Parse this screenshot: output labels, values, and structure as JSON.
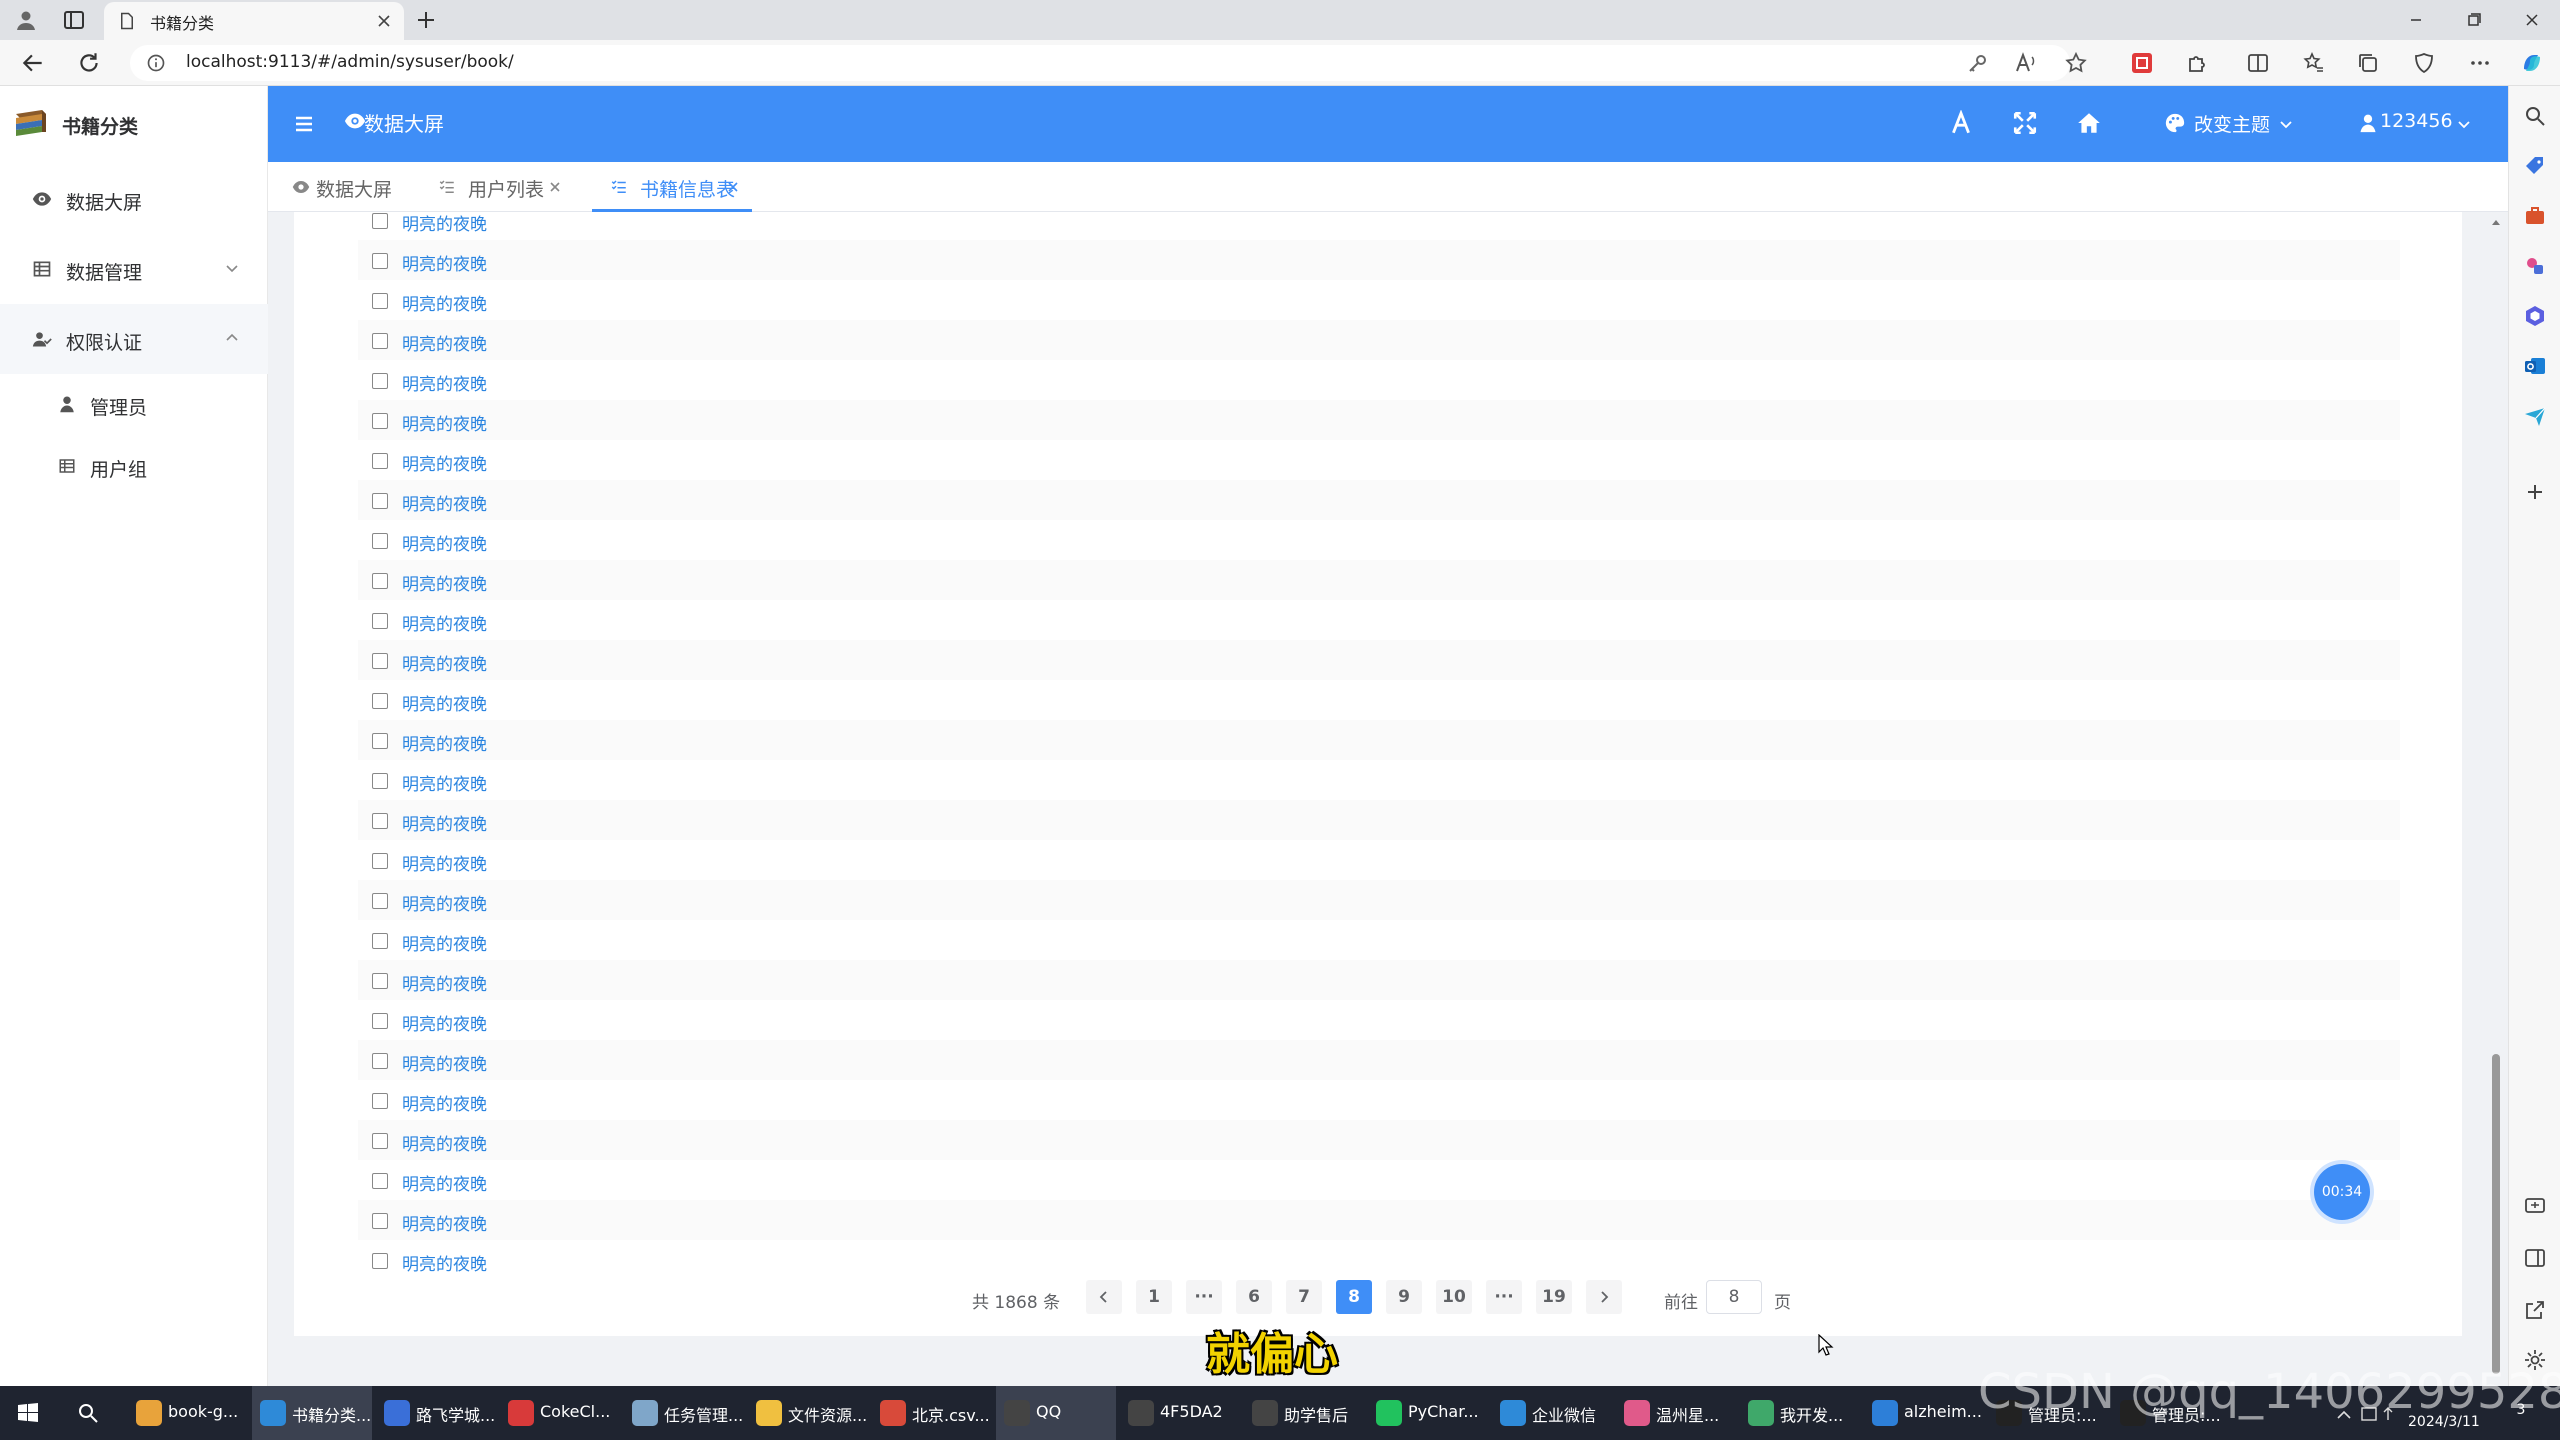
{
  "browser": {
    "tab_title": "书籍分类",
    "url": "localhost:9113/#/admin/sysuser/book/"
  },
  "sidebar": {
    "brand": "书籍分类",
    "items": [
      {
        "label": "数据大屏",
        "icon": "eye-icon"
      },
      {
        "label": "数据管理",
        "icon": "table-icon",
        "expanded": false
      },
      {
        "label": "权限认证",
        "icon": "user-group-icon",
        "expanded": true
      }
    ],
    "subitems": [
      {
        "label": "管理员",
        "icon": "user-icon"
      },
      {
        "label": "用户组",
        "icon": "table-icon"
      }
    ]
  },
  "header": {
    "title": "数据大屏",
    "theme_label": "改变主题",
    "user_label": "123456"
  },
  "tags": [
    {
      "label": "数据大屏",
      "active": false
    },
    {
      "label": "用户列表",
      "active": false
    },
    {
      "label": "书籍信息表",
      "active": true
    }
  ],
  "table": {
    "rows": [
      "明亮的夜晚",
      "明亮的夜晚",
      "明亮的夜晚",
      "明亮的夜晚",
      "明亮的夜晚",
      "明亮的夜晚",
      "明亮的夜晚",
      "明亮的夜晚",
      "明亮的夜晚",
      "明亮的夜晚",
      "明亮的夜晚",
      "明亮的夜晚",
      "明亮的夜晚",
      "明亮的夜晚",
      "明亮的夜晚",
      "明亮的夜晚",
      "明亮的夜晚",
      "明亮的夜晚",
      "明亮的夜晚",
      "明亮的夜晚",
      "明亮的夜晚",
      "明亮的夜晚",
      "明亮的夜晚",
      "明亮的夜晚",
      "明亮的夜晚",
      "明亮的夜晚",
      "明亮的夜晚"
    ]
  },
  "pagination": {
    "total": "共 1868 条",
    "pages": [
      "1",
      "···",
      "6",
      "7",
      "8",
      "9",
      "10",
      "···",
      "19"
    ],
    "current": "8",
    "goto_label": "前往",
    "goto_value": "8",
    "page_unit": "页"
  },
  "overlay": {
    "timer": "00:34",
    "subtitle": "就偏心",
    "watermark": "CSDN @qq_1406299528"
  },
  "taskbar": {
    "items": [
      {
        "label": "book-g...",
        "color": "#e8a33b"
      },
      {
        "label": "书籍分类...",
        "color": "#2e8ad8",
        "active": true
      },
      {
        "label": "路飞学城...",
        "color": "#3a6fd8"
      },
      {
        "label": "CokeCl...",
        "color": "#d83a3a"
      },
      {
        "label": "任务管理...",
        "color": "#7fa6c9"
      },
      {
        "label": "文件资源...",
        "color": "#f0c040"
      },
      {
        "label": "北京.csv...",
        "color": "#d84a3a"
      },
      {
        "label": "QQ",
        "color": "#444444",
        "active": true
      },
      {
        "label": "4F5DA2",
        "color": "#444444"
      },
      {
        "label": "助学售后",
        "color": "#444444"
      },
      {
        "label": "PyChar...",
        "color": "#21c25e"
      },
      {
        "label": "企业微信",
        "color": "#2e8ad8"
      },
      {
        "label": "温州星...",
        "color": "#e05a8a"
      },
      {
        "label": "我开发...",
        "color": "#3fa86a"
      },
      {
        "label": "alzheim...",
        "color": "#2d7fd8"
      },
      {
        "label": "管理员:...",
        "color": "#222222"
      },
      {
        "label": "管理员:...",
        "color": "#222222"
      }
    ],
    "time": "15:??",
    "date": "2024/3/11",
    "notifications": "3"
  }
}
